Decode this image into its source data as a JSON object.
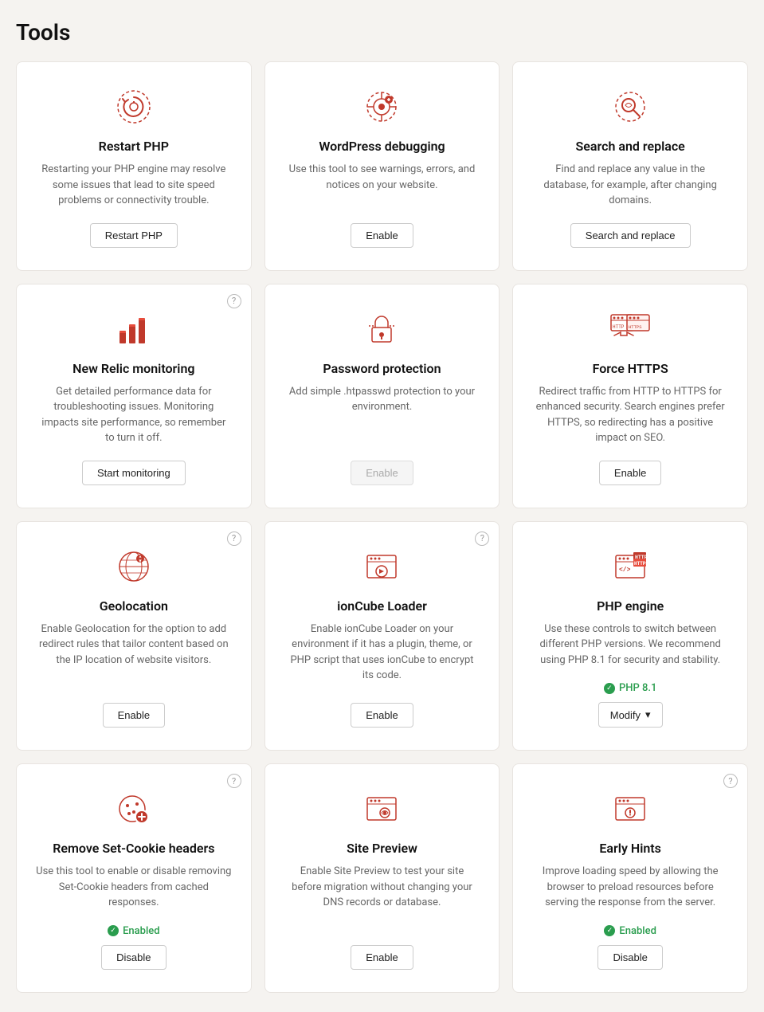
{
  "page": {
    "title": "Tools"
  },
  "cards": [
    {
      "id": "restart-php",
      "title": "Restart PHP",
      "desc": "Restarting your PHP engine may resolve some issues that lead to site speed problems or connectivity trouble.",
      "button": "Restart PHP",
      "button_type": "normal",
      "has_info": false,
      "icon": "restart-php-icon"
    },
    {
      "id": "wordpress-debugging",
      "title": "WordPress debugging",
      "desc": "Use this tool to see warnings, errors, and notices on your website.",
      "button": "Enable",
      "button_type": "normal",
      "has_info": false,
      "icon": "wordpress-debugging-icon"
    },
    {
      "id": "search-replace",
      "title": "Search and replace",
      "desc": "Find and replace any value in the database, for example, after changing domains.",
      "button": "Search and replace",
      "button_type": "normal",
      "has_info": false,
      "icon": "search-replace-icon"
    },
    {
      "id": "new-relic",
      "title": "New Relic monitoring",
      "desc": "Get detailed performance data for troubleshooting issues. Monitoring impacts site performance, so remember to turn it off.",
      "button": "Start monitoring",
      "button_type": "normal",
      "has_info": true,
      "icon": "new-relic-icon"
    },
    {
      "id": "password-protection",
      "title": "Password protection",
      "desc": "Add simple .htpasswd protection to your environment.",
      "button": "Enable",
      "button_type": "disabled",
      "has_info": false,
      "icon": "password-protection-icon"
    },
    {
      "id": "force-https",
      "title": "Force HTTPS",
      "desc": "Redirect traffic from HTTP to HTTPS for enhanced security. Search engines prefer HTTPS, so redirecting has a positive impact on SEO.",
      "button": "Enable",
      "button_type": "normal",
      "has_info": false,
      "icon": "force-https-icon"
    },
    {
      "id": "geolocation",
      "title": "Geolocation",
      "desc": "Enable Geolocation for the option to add redirect rules that tailor content based on the IP location of website visitors.",
      "button": "Enable",
      "button_type": "normal",
      "has_info": true,
      "icon": "geolocation-icon"
    },
    {
      "id": "ioncube-loader",
      "title": "ionCube Loader",
      "desc": "Enable ionCube Loader on your environment if it has a plugin, theme, or PHP script that uses ionCube to encrypt its code.",
      "button": "Enable",
      "button_type": "normal",
      "has_info": true,
      "icon": "ioncube-loader-icon"
    },
    {
      "id": "php-engine",
      "title": "PHP engine",
      "desc": "Use these controls to switch between different PHP versions. We recommend using PHP 8.1 for security and stability.",
      "button": "Modify",
      "button_type": "modify",
      "has_info": false,
      "icon": "php-engine-icon",
      "php_version": "PHP 8.1"
    },
    {
      "id": "remove-set-cookie",
      "title": "Remove Set-Cookie headers",
      "desc": "Use this tool to enable or disable removing Set-Cookie headers from cached responses.",
      "button": "Disable",
      "button_type": "normal",
      "has_info": true,
      "icon": "remove-cookie-icon",
      "status": "Enabled"
    },
    {
      "id": "site-preview",
      "title": "Site Preview",
      "desc": "Enable Site Preview to test your site before migration without changing your DNS records or database.",
      "button": "Enable",
      "button_type": "normal",
      "has_info": false,
      "icon": "site-preview-icon"
    },
    {
      "id": "early-hints",
      "title": "Early Hints",
      "desc": "Improve loading speed by allowing the browser to preload resources before serving the response from the server.",
      "button": "Disable",
      "button_type": "normal",
      "has_info": true,
      "icon": "early-hints-icon",
      "status": "Enabled"
    }
  ]
}
